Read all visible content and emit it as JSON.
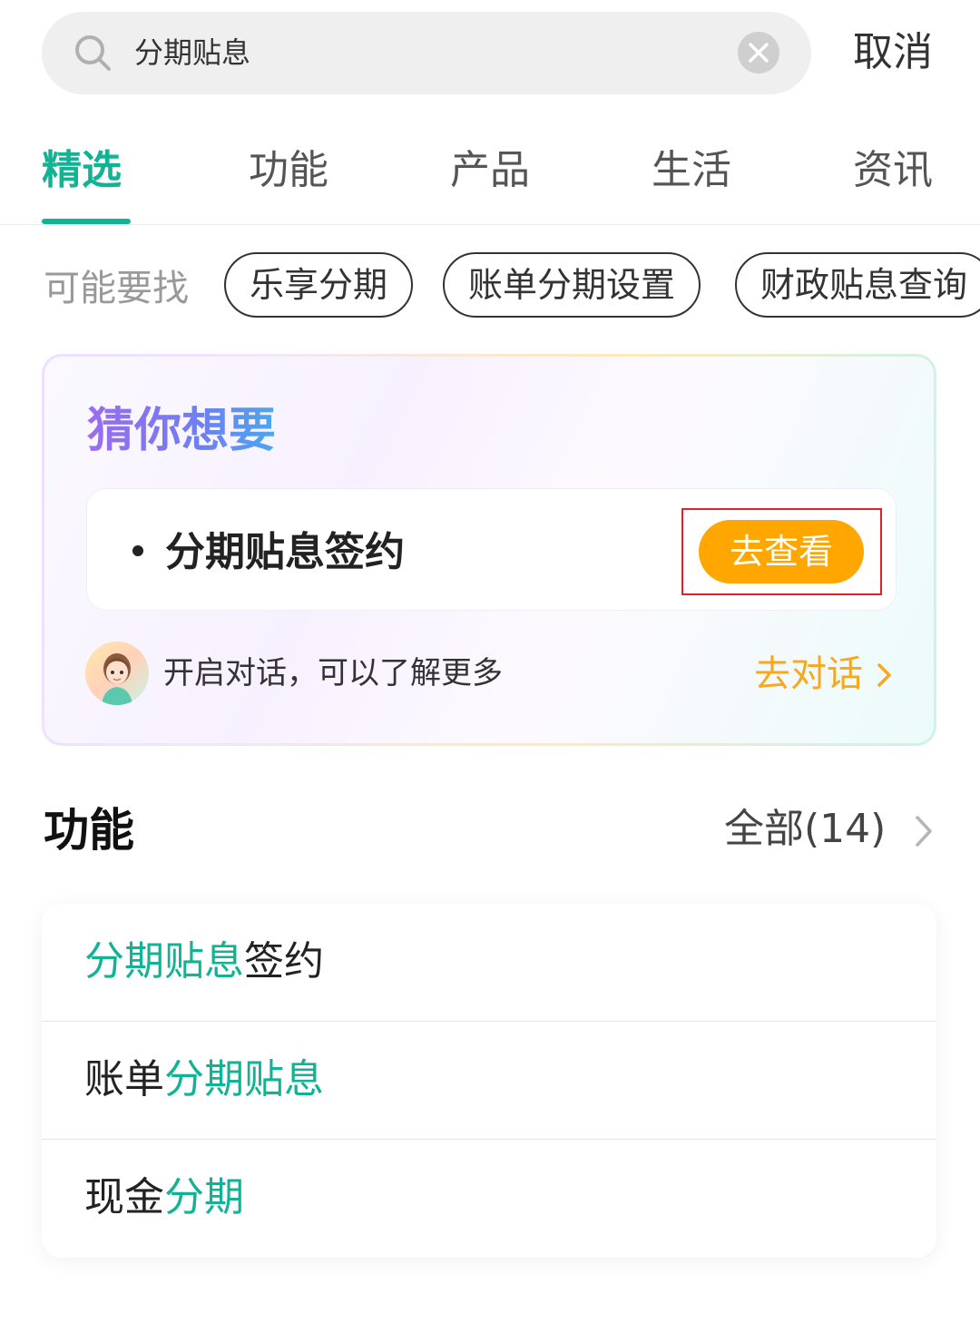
{
  "search": {
    "query": "分期贴息",
    "cancel_label": "取消"
  },
  "tabs": [
    {
      "label": "精选",
      "active": true
    },
    {
      "label": "功能",
      "active": false
    },
    {
      "label": "产品",
      "active": false
    },
    {
      "label": "生活",
      "active": false
    },
    {
      "label": "资讯",
      "active": false
    }
  ],
  "suggestions": {
    "label": "可能要找",
    "chips": [
      "乐享分期",
      "账单分期设置",
      "财政贴息查询"
    ]
  },
  "guess": {
    "title": "猜你想要",
    "item_label": "分期贴息签约",
    "view_button": "去查看",
    "chat_text": "开启对话，可以了解更多",
    "chat_link": "去对话"
  },
  "functions": {
    "title": "功能",
    "all_label": "全部(14)",
    "rows": [
      {
        "highlight": "分期贴息",
        "rest": "签约",
        "order": "hl-first"
      },
      {
        "prefix": "账单",
        "highlight": "分期贴息",
        "order": "hl-last"
      },
      {
        "prefix": "现金",
        "highlight": "分期",
        "order": "hl-last"
      }
    ]
  },
  "colors": {
    "accent": "#12b394",
    "orange_button": "#ffa600",
    "chat_link": "#f7a81e",
    "highlight_box": "#e0202a"
  }
}
